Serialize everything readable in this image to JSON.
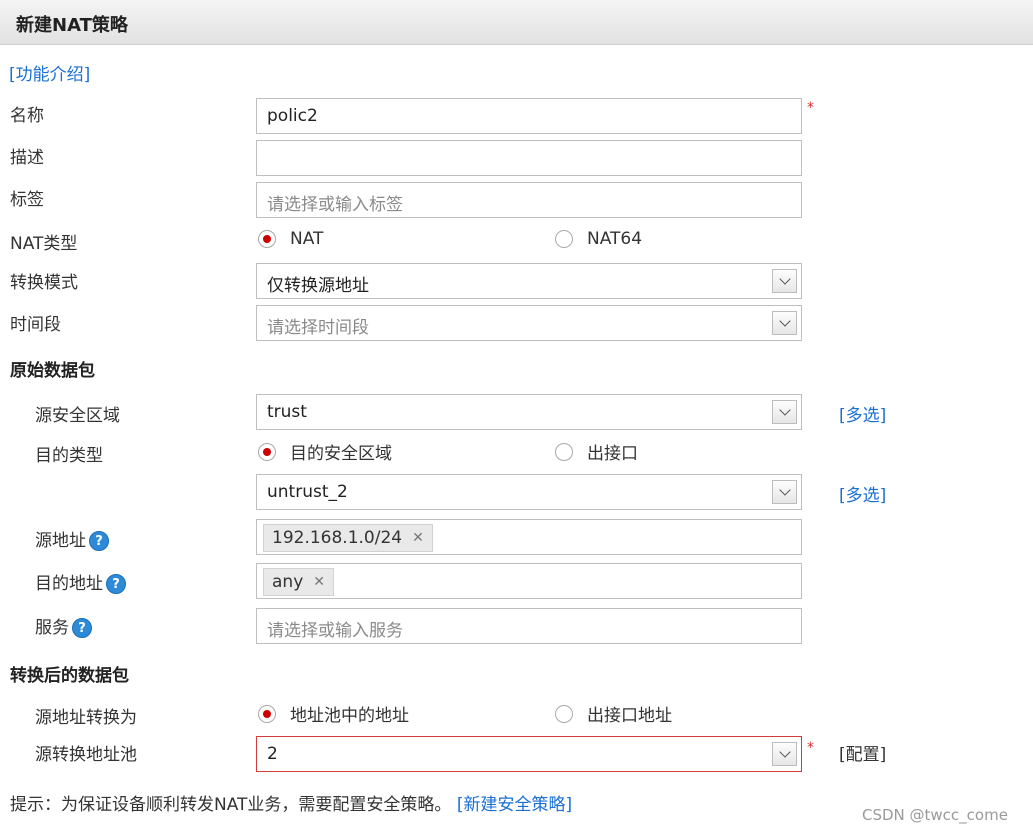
{
  "header": {
    "title": "新建NAT策略"
  },
  "intro_link": "[功能介绍]",
  "form": {
    "name": {
      "label": "名称",
      "value": "polic2"
    },
    "description": {
      "label": "描述",
      "value": ""
    },
    "tag": {
      "label": "标签",
      "placeholder": "请选择或输入标签"
    },
    "nat_type": {
      "label": "NAT类型",
      "options": [
        "NAT",
        "NAT64"
      ],
      "selected": "NAT"
    },
    "mode": {
      "label": "转换模式",
      "value": "仅转换源地址"
    },
    "time_range": {
      "label": "时间段",
      "placeholder": "请选择时间段"
    }
  },
  "original_packet": {
    "title": "原始数据包",
    "src_zone": {
      "label": "源安全区域",
      "value": "trust",
      "multi": "[多选]"
    },
    "dst_type": {
      "label": "目的类型",
      "options": [
        "目的安全区域",
        "出接口"
      ],
      "selected": "目的安全区域"
    },
    "dst_zone": {
      "value": "untrust_2",
      "multi": "[多选]"
    },
    "src_addr": {
      "label": "源地址",
      "tags": [
        "192.168.1.0/24"
      ]
    },
    "dst_addr": {
      "label": "目的地址",
      "tags": [
        "any"
      ]
    },
    "service": {
      "label": "服务",
      "placeholder": "请选择或输入服务"
    }
  },
  "translated_packet": {
    "title": "转换后的数据包",
    "src_translate": {
      "label": "源地址转换为",
      "options": [
        "地址池中的地址",
        "出接口地址"
      ],
      "selected": "地址池中的地址"
    },
    "pool": {
      "label": "源转换地址池",
      "value": "2",
      "config": "[配置]"
    }
  },
  "tip": {
    "text": "提示：为保证设备顺利转发NAT业务，需要配置安全策略。",
    "link": "[新建安全策略]"
  },
  "watermark": "CSDN @twcc_come",
  "colors": {
    "link": "#1a6fd4",
    "required": "#e03030",
    "radio_selected": "#cc0000",
    "help_icon": "#2d8ad8"
  }
}
